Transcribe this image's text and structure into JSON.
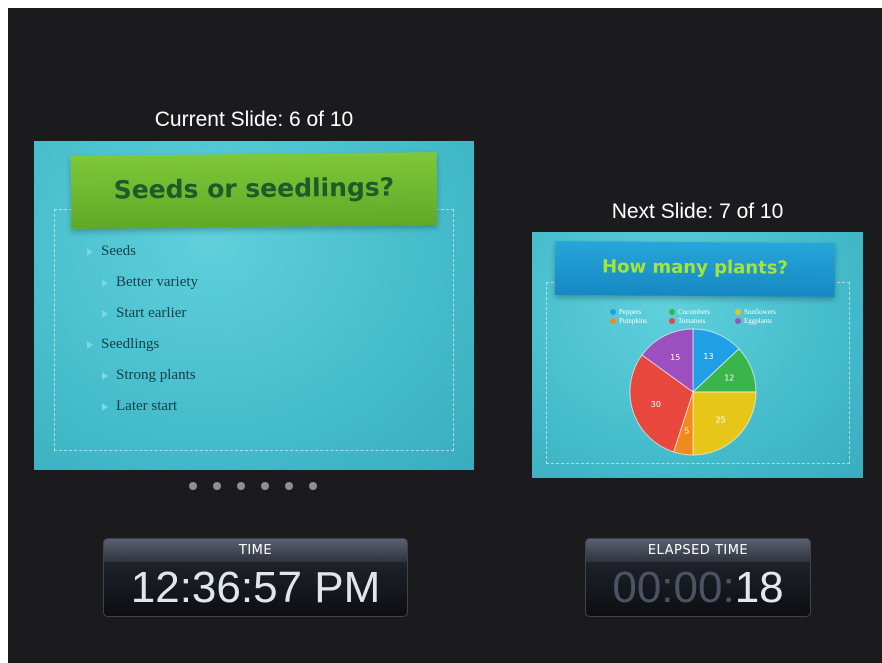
{
  "current": {
    "label": "Current Slide: 6 of 10",
    "title": "Seeds or seedlings?",
    "bullets": [
      {
        "text": "Seeds",
        "level": 1
      },
      {
        "text": "Better variety",
        "level": 2
      },
      {
        "text": "Start earlier",
        "level": 2
      },
      {
        "text": "Seedlings",
        "level": 1
      },
      {
        "text": "Strong plants",
        "level": 2
      },
      {
        "text": "Later start",
        "level": 2
      }
    ]
  },
  "next": {
    "label": "Next Slide: 7 of 10",
    "title": "How many plants?"
  },
  "pager": {
    "count": 6
  },
  "time": {
    "label": "TIME",
    "value": "12:36:57 PM"
  },
  "elapsed": {
    "label": "ELAPSED TIME",
    "dim": "00:00:",
    "bright": "18"
  },
  "chart_data": {
    "type": "pie",
    "legend_position": "top",
    "slices": [
      {
        "name": "Peppers",
        "value": 13,
        "color": "#1e9fe6"
      },
      {
        "name": "Cucumbers",
        "value": 12,
        "color": "#39b54a"
      },
      {
        "name": "Sunflowers",
        "value": 25,
        "color": "#e6c619"
      },
      {
        "name": "Pumpkins",
        "value": 5,
        "color": "#f2891d"
      },
      {
        "name": "Tomatoes",
        "value": 30,
        "color": "#e8473e"
      },
      {
        "name": "Eggplants",
        "value": 15,
        "color": "#9c4fbf"
      }
    ]
  }
}
